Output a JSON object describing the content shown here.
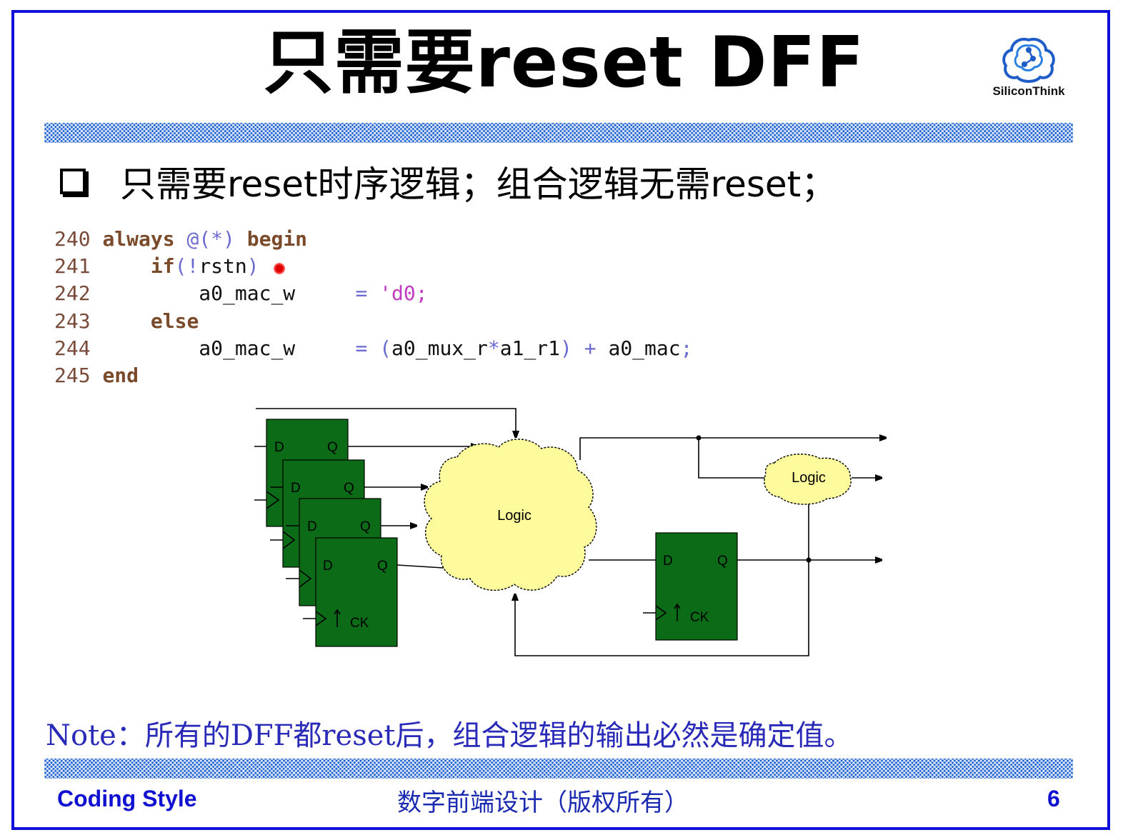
{
  "slide": {
    "title": "只需要reset DFF",
    "logo_text": "SiliconThink",
    "bullet": "只需要reset时序逻辑；组合逻辑无需reset；",
    "code": [
      {
        "ln": "240",
        "a": "always",
        "b": " @(*) ",
        "c": "begin"
      },
      {
        "ln": "241",
        "pre": "    ",
        "a": "if",
        "b": "(!",
        "c": "rstn",
        "d": ")"
      },
      {
        "ln": "242",
        "pre": "        ",
        "a": "a0_mac_w",
        "b": "     = ",
        "c": "'d0;"
      },
      {
        "ln": "243",
        "pre": "    ",
        "a": "else"
      },
      {
        "ln": "244",
        "pre": "        ",
        "a": "a0_mac_w",
        "b": "     = (",
        "c": "a0_mux_r",
        "d": "*",
        "e": "a1_r1",
        "f": ") + ",
        "g": "a0_mac",
        "h": ";"
      },
      {
        "ln": "245",
        "a": "end"
      }
    ],
    "diagram": {
      "logic_label": "Logic",
      "small_logic_label": "Logic",
      "ff_d": "D",
      "ff_q": "Q",
      "ff_ck": "CK"
    },
    "note": "Note：所有的DFF都reset后，组合逻辑的输出必然是确定值。",
    "footer_left": "Coding Style",
    "footer_center": "数字前端设计（版权所有）",
    "page_number": "6"
  },
  "colors": {
    "frame": "#1010d8",
    "hatch": "#1a5fd0",
    "ff_fill": "#0b6b16",
    "cloud_fill": "#fdfb9c",
    "note": "#2a2ab8"
  }
}
